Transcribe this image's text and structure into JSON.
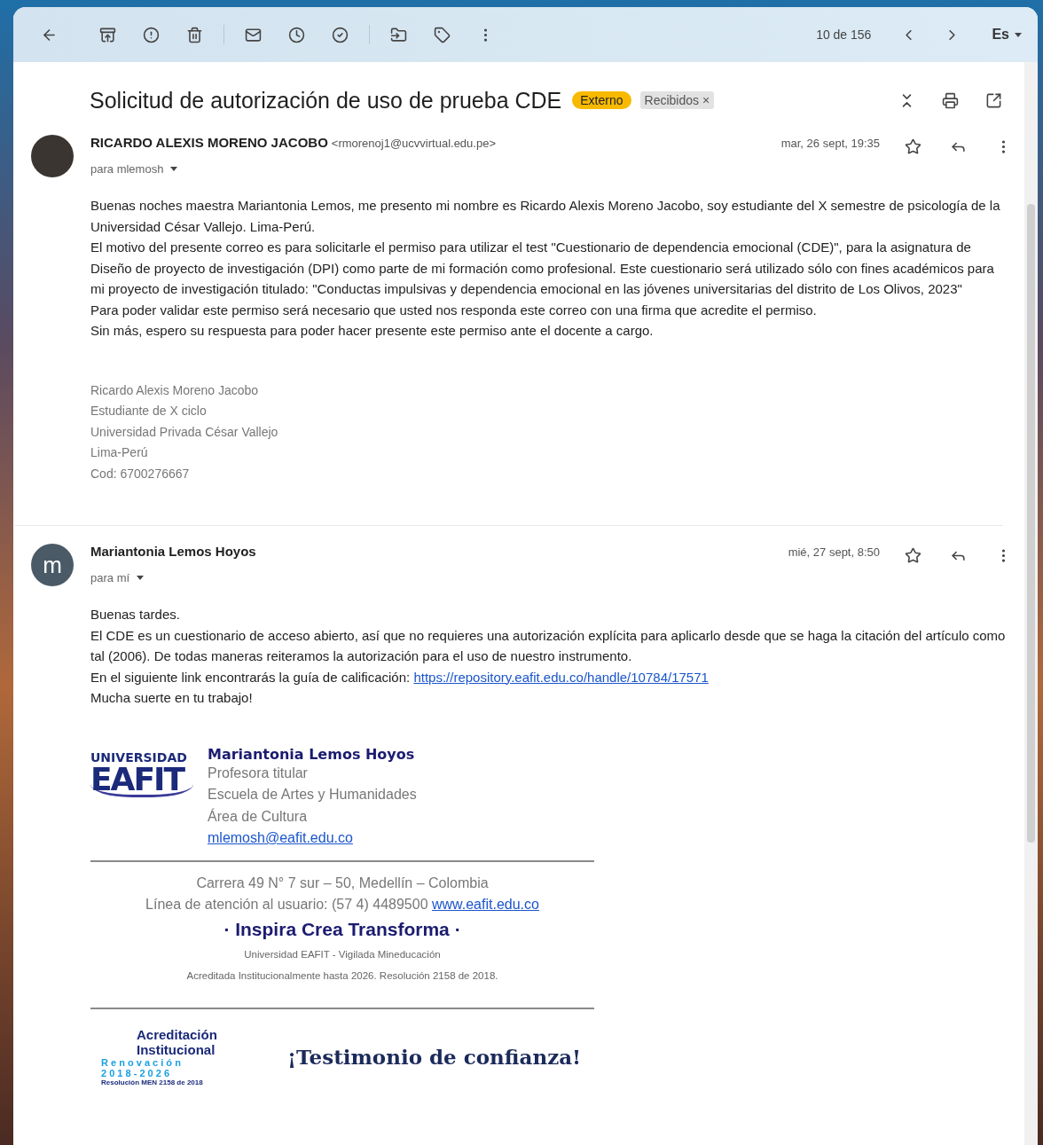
{
  "toolbar": {
    "counter": "10 de 156",
    "input_tool": "Es"
  },
  "subject": {
    "title": "Solicitud de autorización de uso de prueba CDE",
    "labels": [
      {
        "kind": "tag",
        "text": "Externo"
      },
      {
        "kind": "removable",
        "text": "Recibidos",
        "remove": "×"
      }
    ]
  },
  "messages": [
    {
      "avatar": {
        "kind": "photo"
      },
      "sender": "RICARDO ALEXIS MORENO JACOBO",
      "email": "<rmorenoj1@ucvvirtual.edu.pe>",
      "recipient": "para mlemosh",
      "date": "mar, 26 sept, 19:35",
      "paragraphs": [
        {
          "text": "Buenas noches maestra Mariantonia Lemos, me presento mi nombre es Ricardo Alexis Moreno Jacobo, soy estudiante del X semestre de psicología de la Universidad César Vallejo. Lima-Perú."
        },
        {
          "text": "El motivo del presente correo es para solicitarle el permiso para utilizar el test \"Cuestionario de dependencia emocional (CDE)\", para la asignatura de Diseño de proyecto de investigación (DPI) como parte de mi formación como profesional. Este cuestionario será utilizado sólo con fines académicos para mi proyecto de investigación titulado: \"Conductas impulsivas y dependencia emocional en las jóvenes universitarias del distrito de Los Olivos, 2023\""
        },
        {
          "text": "Para poder validar este permiso será necesario que usted nos responda este correo con una firma que acredite el permiso."
        },
        {
          "text": "Sin más, espero su respuesta para poder hacer presente este permiso ante el docente a cargo."
        }
      ],
      "signature": [
        "Ricardo Alexis Moreno Jacobo",
        "Estudiante de X ciclo",
        "Universidad Privada César Vallejo",
        "Lima-Perú",
        "Cod: 6700276667"
      ]
    },
    {
      "avatar": {
        "kind": "letter",
        "letter": "m"
      },
      "sender": "Mariantonia Lemos Hoyos",
      "recipient": "para mí",
      "date": "mié, 27 sept, 8:50",
      "paragraphs": [
        {
          "text": "Buenas tardes."
        },
        {
          "text": "El CDE es un cuestionario de acceso abierto, así que no requieres una autorización explícita para aplicarlo desde que se haga la citación del artículo como tal (2006). De todas maneras reiteramos la autorización para el uso de nuestro instrumento."
        },
        {
          "text": "En el siguiente link encontrarás la guía de calificación: ",
          "link": "https://repository.eafit.edu.co/handle/10784/17571"
        },
        {
          "text": "Mucha suerte en tu trabajo!"
        }
      ],
      "eafit_signature": {
        "logo_top": "UNIVERSIDAD",
        "logo_main": "EAFIT",
        "name": "Mariantonia Lemos Hoyos",
        "lines": [
          "Profesora titular",
          "Escuela de Artes y Humanidades",
          "Área de Cultura"
        ],
        "email": "mlemosh@eafit.edu.co",
        "address": "Carrera 49 N° 7 sur – 50, Medellín – Colombia",
        "phone": "Línea de atención al usuario: (57 4) 4489500",
        "website": "www.eafit.edu.co",
        "motto": "· Inspira Crea Transforma ·",
        "fine_print": [
          "Universidad EAFIT - Vigilada Mineducación",
          "Acreditada Institucionalmente hasta 2026. Resolución 2158 de 2018."
        ],
        "accreditation": {
          "title_1": "Acreditación",
          "title_2": "Institucional",
          "renewal": "R e n o v a c i ó n",
          "years": "2 0 1 8 - 2 0 2 6",
          "resolution": "Resolución MEN 2158 de 2018"
        },
        "slogan": "¡Testimonio de confianza!"
      }
    }
  ]
}
